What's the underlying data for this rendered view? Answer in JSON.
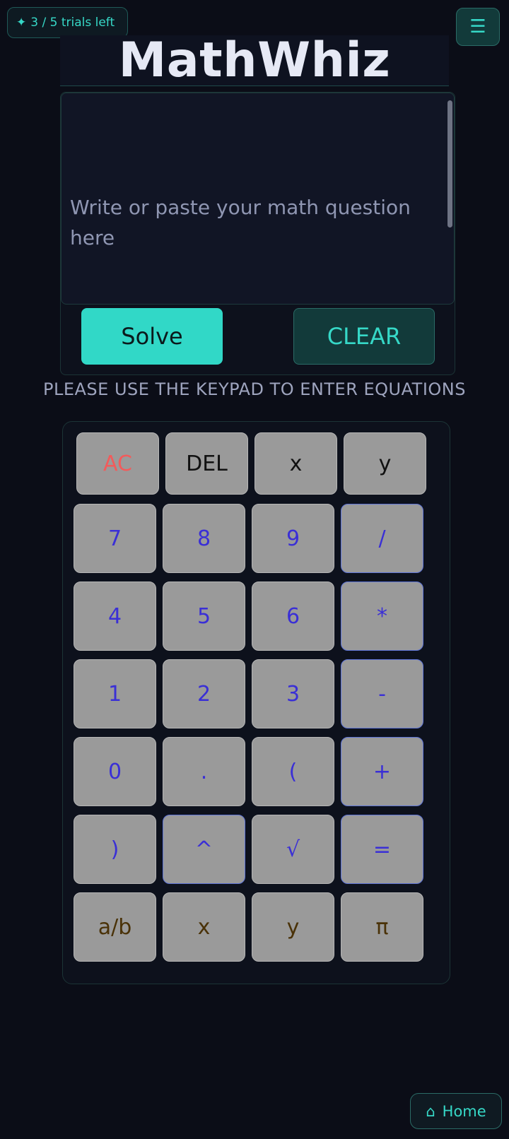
{
  "header": {
    "trials_icon": "sparkle-icon",
    "trials_text": "3 / 5 trials left",
    "menu_icon": "hamburger-icon",
    "app_title": "MathWhiz"
  },
  "editor": {
    "placeholder": "Write or paste your math question here",
    "solve_label": "Solve",
    "clear_label": "CLEAR"
  },
  "instruction": "PLEASE USE THE KEYPAD TO ENTER EQUATIONS",
  "keypad": {
    "top_row": [
      "AC",
      "DEL",
      "x",
      "y"
    ],
    "rows": [
      [
        "7",
        "8",
        "9",
        "/"
      ],
      [
        "4",
        "5",
        "6",
        "*"
      ],
      [
        "1",
        "2",
        "3",
        "-"
      ],
      [
        "0",
        ".",
        "(",
        "+"
      ],
      [
        ")",
        "^",
        "√",
        "="
      ],
      [
        "a/b",
        "x",
        "y",
        "π"
      ]
    ]
  },
  "footer": {
    "home_icon": "home-icon",
    "home_label": "Home"
  },
  "colors": {
    "background": "#0b0d17",
    "accent": "#31d8c7",
    "key_background": "#9a9a9a",
    "key_number_text": "#3a2fd6",
    "key_clear_text": "#f25b5b",
    "key_variable_text": "#4a3208"
  }
}
